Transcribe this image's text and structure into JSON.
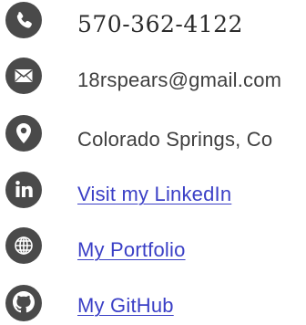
{
  "contact": {
    "phone": "570-362-4122",
    "email": "18rspears@gmail.com",
    "location": "Colorado Springs, Co",
    "linkedin_label": "Visit my LinkedIn",
    "portfolio_label": "My Portfolio",
    "github_label": "My GitHub"
  },
  "icons": {
    "phone": "phone-icon",
    "email": "envelope-icon",
    "location": "map-pin-icon",
    "linkedin": "linkedin-icon",
    "portfolio": "globe-icon",
    "github": "github-icon"
  },
  "colors": {
    "icon": "#4a4a4a",
    "text": "#3f3f3f",
    "link": "#3a3fc6"
  }
}
